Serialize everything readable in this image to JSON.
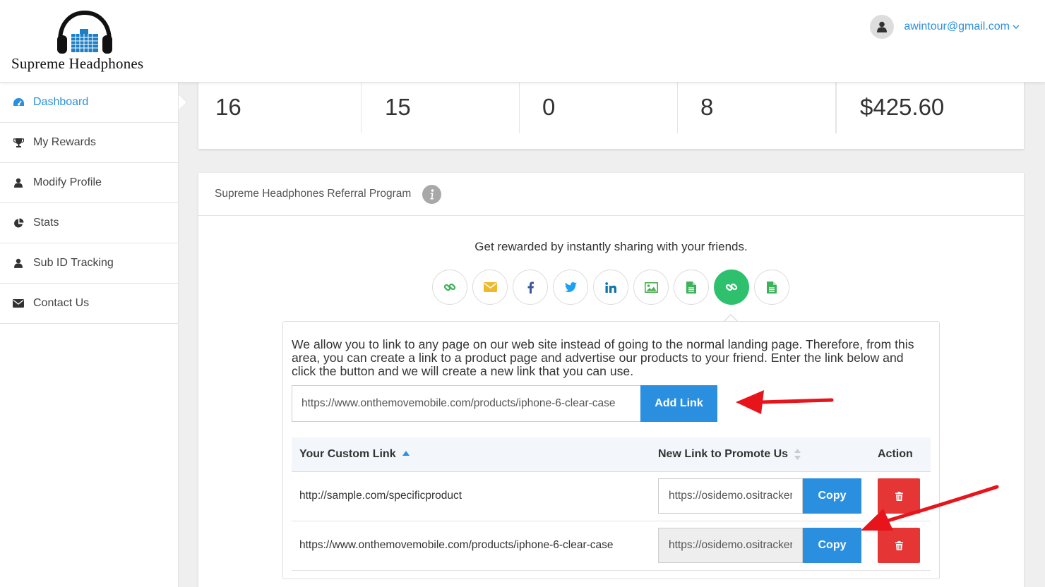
{
  "header": {
    "logo_text": "Supreme Headphones",
    "user_email": "awintour@gmail.com"
  },
  "sidebar": {
    "items": [
      {
        "label": "Dashboard",
        "icon": "dashboard-icon",
        "active": true
      },
      {
        "label": "My Rewards",
        "icon": "trophy-icon"
      },
      {
        "label": "Modify Profile",
        "icon": "user-icon"
      },
      {
        "label": "Stats",
        "icon": "pie-chart-icon"
      },
      {
        "label": "Sub ID Tracking",
        "icon": "user-icon"
      },
      {
        "label": "Contact Us",
        "icon": "envelope-icon"
      }
    ]
  },
  "stats": [
    "16",
    "15",
    "0",
    "8",
    "$425.60"
  ],
  "referral": {
    "title": "Supreme Headphones Referral Program",
    "tagline": "Get rewarded by instantly sharing with your friends.",
    "share_buttons": [
      "link-icon",
      "email-icon",
      "facebook-icon",
      "twitter-icon",
      "linkedin-icon",
      "image-icon",
      "document-icon",
      "link-icon",
      "document-icon"
    ],
    "description": "We allow you to link to any page on our web site instead of going to the normal landing page. Therefore, from this area, you can create a link to a product page and advertise our products to your friend. Enter the link below and click the button and we will create a new link that you can use.",
    "url_input_value": "https://www.onthemovemobile.com/products/iphone-6-clear-case",
    "add_button": "Add Link",
    "table": {
      "headers": [
        "Your Custom Link",
        "New Link to Promote Us",
        "Action"
      ],
      "rows": [
        {
          "custom_link": "http://sample.com/specificproduct",
          "promo_link": "https://osidemo.ositracker",
          "copy": "Copy"
        },
        {
          "custom_link": "https://www.onthemovemobile.com/products/iphone-6-clear-case",
          "promo_link": "https://osidemo.ositracker",
          "copy": "Copy"
        }
      ]
    }
  },
  "colors": {
    "accent": "#2b8fe0",
    "danger": "#e53535",
    "share_active": "#2fc06e",
    "annotation_arrow": "#e8141c"
  }
}
